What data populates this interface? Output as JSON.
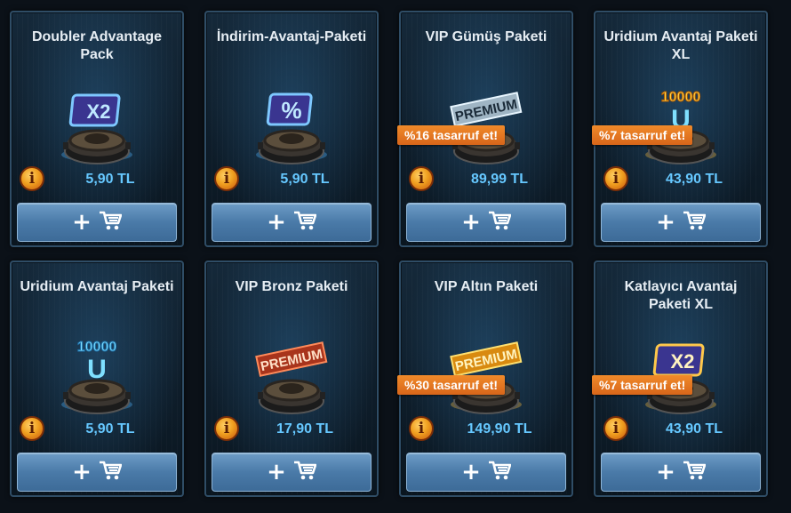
{
  "products": [
    {
      "title": "Doubler Advantage Pack",
      "price": "5,90 TL",
      "badge": "",
      "art": "x2-blue-icon"
    },
    {
      "title": "İndirim-Avantaj-Paketi",
      "price": "5,90 TL",
      "badge": "",
      "art": "percent-icon"
    },
    {
      "title": "VIP Gümüş Paketi",
      "price": "89,99 TL",
      "badge": "%16 tasarruf et!",
      "art": "premium-silver-icon"
    },
    {
      "title": "Uridium Avantaj Paketi XL",
      "price": "43,90 TL",
      "badge": "%7 tasarruf et!",
      "art": "uridium-gold-icon"
    },
    {
      "title": "Uridium Avantaj Paketi",
      "price": "5,90 TL",
      "badge": "",
      "art": "uridium-blue-icon"
    },
    {
      "title": "VIP Bronz Paketi",
      "price": "17,90 TL",
      "badge": "",
      "art": "premium-bronze-icon"
    },
    {
      "title": "VIP Altın Paketi",
      "price": "149,90 TL",
      "badge": "%30 tasarruf et!",
      "art": "premium-gold-icon"
    },
    {
      "title": "Katlayıcı Avantaj Paketi XL",
      "price": "43,90 TL",
      "badge": "%7 tasarruf et!",
      "art": "x2-gold-icon"
    }
  ],
  "info_icon": "i",
  "buy_plus": "+",
  "colors": {
    "price": "#66c8ff",
    "badge": "#e8761f",
    "button": "#4a7aa8"
  }
}
